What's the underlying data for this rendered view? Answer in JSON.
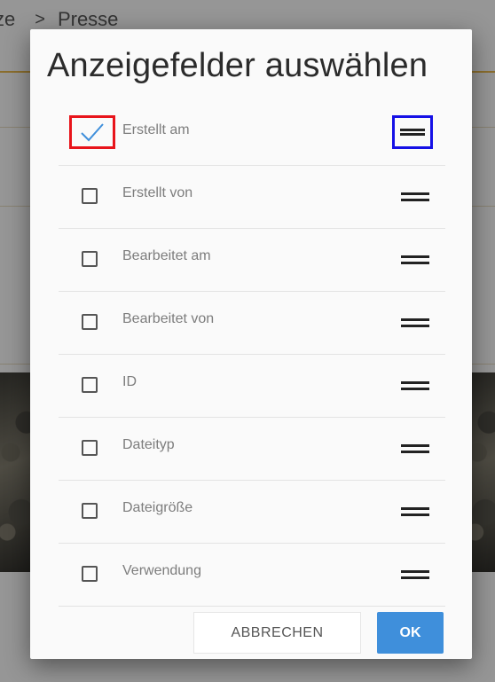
{
  "background": {
    "breadcrumb": {
      "previous": "ze",
      "separator": ">",
      "current": "Presse"
    }
  },
  "dialog": {
    "title": "Anzeigefelder auswählen",
    "fields": [
      {
        "label": "Erstellt am",
        "checked": true
      },
      {
        "label": "Erstellt von",
        "checked": false
      },
      {
        "label": "Bearbeitet am",
        "checked": false
      },
      {
        "label": "Bearbeitet von",
        "checked": false
      },
      {
        "label": "ID",
        "checked": false
      },
      {
        "label": "Dateityp",
        "checked": false
      },
      {
        "label": "Dateigröße",
        "checked": false
      },
      {
        "label": "Verwendung",
        "checked": false
      }
    ],
    "cancel_label": "ABBRECHEN",
    "ok_label": "OK"
  },
  "colors": {
    "accent": "#3f8fdb",
    "check": "#3f8fdb",
    "highlight_checkbox": "#e8141b",
    "highlight_handle": "#1510e6"
  },
  "icons": {
    "checkmark": "checkmark-icon",
    "drag": "drag-handle-icon"
  }
}
